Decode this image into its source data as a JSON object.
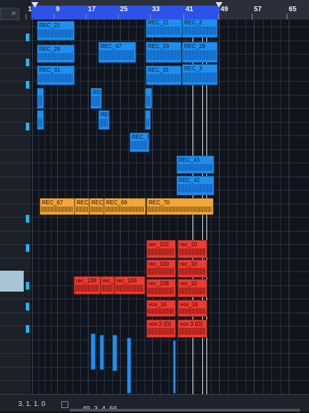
{
  "ruler": {
    "ticks": [
      {
        "label": "1"
      },
      {
        "label": "9"
      },
      {
        "label": "17"
      },
      {
        "label": "25"
      },
      {
        "label": "33"
      },
      {
        "label": "41"
      },
      {
        "label": "49"
      },
      {
        "label": "57"
      },
      {
        "label": "65"
      }
    ]
  },
  "events": [
    {
      "label": "REC_21",
      "color": "blue"
    },
    {
      "label": "REC_21",
      "color": "blue"
    },
    {
      "label": "REC_2",
      "color": "blue"
    },
    {
      "label": "REC_29",
      "color": "blue"
    },
    {
      "label": "REC_47",
      "color": "blue"
    },
    {
      "label": "REC_29",
      "color": "blue"
    },
    {
      "label": "REC_29",
      "color": "blue"
    },
    {
      "label": "REC_31",
      "color": "blue"
    },
    {
      "label": "REC_31",
      "color": "blue"
    },
    {
      "label": "REC_3",
      "color": "blue"
    },
    {
      "label": "",
      "color": "blue"
    },
    {
      "label": "REC",
      "color": "blue"
    },
    {
      "label": "",
      "color": "blue"
    },
    {
      "label": "",
      "color": "blue"
    },
    {
      "label": "REC",
      "color": "blue"
    },
    {
      "label": "",
      "color": "blue"
    },
    {
      "label": "REC_G",
      "color": "blue"
    },
    {
      "label": "REC_43",
      "color": "blue"
    },
    {
      "label": "REC_42",
      "color": "blue"
    },
    {
      "label": "REC_67",
      "color": "orange"
    },
    {
      "label": "REC_",
      "color": "orange"
    },
    {
      "label": "REC_",
      "color": "orange"
    },
    {
      "label": "REC_69",
      "color": "orange"
    },
    {
      "label": "REC_70",
      "color": "orange"
    },
    {
      "label": "rec_102",
      "color": "red"
    },
    {
      "label": "rec_10",
      "color": "red"
    },
    {
      "label": "rec_100",
      "color": "red"
    },
    {
      "label": "rec_10",
      "color": "red"
    },
    {
      "label": "rec_138",
      "color": "red"
    },
    {
      "label": "rec_",
      "color": "red"
    },
    {
      "label": "rec_106",
      "color": "red"
    },
    {
      "label": "rec_108",
      "color": "red"
    },
    {
      "label": "rec_10",
      "color": "red"
    },
    {
      "label": "vox_16",
      "color": "red"
    },
    {
      "label": "vox_16",
      "color": "red"
    },
    {
      "label": "vox 3 (D)",
      "color": "red"
    },
    {
      "label": "vox 3 (D)",
      "color": "red"
    }
  ],
  "transport": {
    "position_left": "3. 1. 1.  0",
    "position_right": "49. 3. 4. 66"
  },
  "colors": {
    "loop_range": "#2d52e8",
    "blue_event": "#1e8ff0",
    "orange_event": "#f3a73a",
    "red_event": "#ee3a30",
    "meter": "#1fb6e8"
  },
  "icons": [
    "search-icon",
    "settings-icon"
  ]
}
